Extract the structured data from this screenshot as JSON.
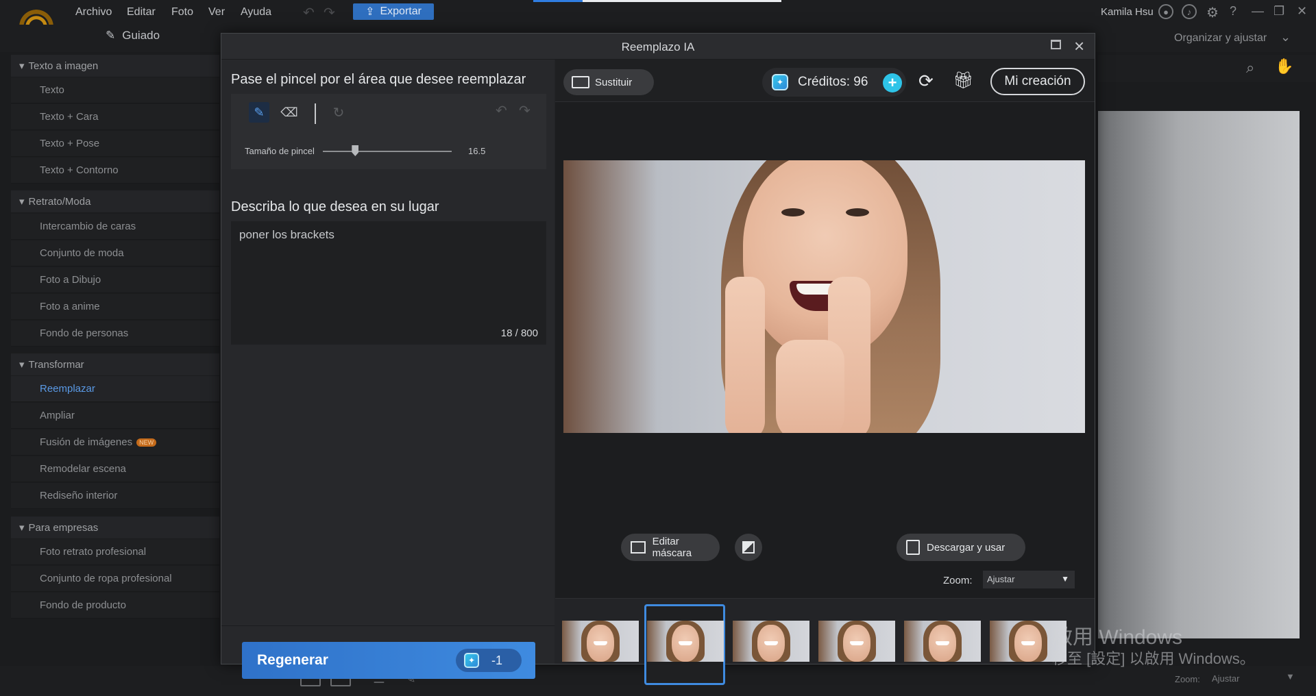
{
  "app": {
    "menu": [
      "Archivo",
      "Editar",
      "Foto",
      "Ver",
      "Ayuda"
    ],
    "export_label": "Exportar",
    "user_name": "Kamila Hsu",
    "guided_tab": "Guiado",
    "organize_tab": "Organizar y ajustar",
    "bottom_zoom_label": "Zoom:",
    "bottom_zoom_value": "Ajustar"
  },
  "sidebar": {
    "sections": [
      {
        "title": "Texto a imagen",
        "items": [
          "Texto",
          "Texto + Cara",
          "Texto + Pose",
          "Texto + Contorno"
        ]
      },
      {
        "title": "Retrato/Moda",
        "items": [
          "Intercambio de caras",
          "Conjunto de moda",
          "Foto a Dibujo",
          "Foto a anime",
          "Fondo de personas"
        ]
      },
      {
        "title": "Transformar",
        "items": [
          "Reemplazar",
          "Ampliar",
          "Fusión de imágenes",
          "Remodelar escena",
          "Rediseño interior"
        ]
      },
      {
        "title": "Para empresas",
        "items": [
          "Foto retrato profesional",
          "Conjunto de ropa profesional",
          "Fondo de producto"
        ]
      }
    ],
    "new_badge": "NEW",
    "active_item": "Reemplazar"
  },
  "dialog": {
    "title": "Reemplazo IA",
    "brush_instruction": "Pase el pincel por el área que desee reemplazar",
    "brush_size_label": "Tamaño de pincel",
    "brush_size_value": "16.5",
    "brush_size_fraction": 0.14,
    "describe_label": "Describa lo que desea en su lugar",
    "prompt_text": "poner los brackets",
    "char_count": "18 / 800",
    "regenerate_label": "Regenerar",
    "regenerate_cost": "-1",
    "replace_button": "Sustituir",
    "credits_text": "Créditos: 96",
    "my_creation_button": "Mi creación",
    "edit_mask_button": "Editar máscara",
    "download_button": "Descargar y usar",
    "zoom_label": "Zoom:",
    "zoom_value": "Ajustar",
    "thumbnails_count": 6,
    "selected_thumbnail": 2
  },
  "watermark": {
    "line1": "啟用 Windows",
    "line2": "移至 [設定] 以啟用 Windows。"
  },
  "colors": {
    "accent": "#3f8be0",
    "credits": "#2ec4e8",
    "active_sidebar": "#5a9ae6"
  }
}
